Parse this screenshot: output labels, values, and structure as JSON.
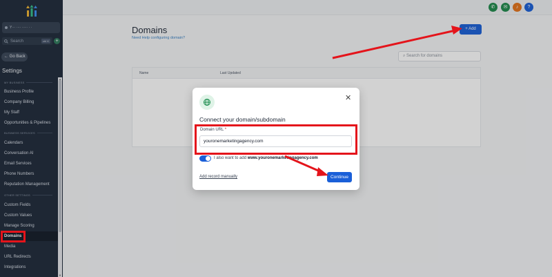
{
  "sidebar": {
    "location_name": "Y··· ···· ····· · ·",
    "search_placeholder": "Search",
    "search_shortcut": "ctrl K",
    "search_add": "+",
    "go_back": "Go Back",
    "settings_title": "Settings",
    "sections": {
      "my_business": "MY BUSINESS",
      "business_services": "BUSINESS SERVICES",
      "other_settings": "OTHER SETTINGS"
    },
    "items": [
      {
        "label": "Business Profile"
      },
      {
        "label": "Company Billing"
      },
      {
        "label": "My Staff"
      },
      {
        "label": "Opportunities & Pipelines"
      },
      {
        "label": "Calendars"
      },
      {
        "label": "Conversation AI"
      },
      {
        "label": "Email Services"
      },
      {
        "label": "Phone Numbers"
      },
      {
        "label": "Reputation Management"
      },
      {
        "label": "Custom Fields"
      },
      {
        "label": "Custom Values"
      },
      {
        "label": "Manage Scoring"
      },
      {
        "label": "Domains"
      },
      {
        "label": "Media"
      },
      {
        "label": "URL Redirects"
      },
      {
        "label": "Integrations"
      }
    ]
  },
  "topbar": {
    "icons": [
      "phone-icon",
      "megaphone-icon",
      "bell-icon",
      "help-icon"
    ],
    "colors": {
      "phone": "#1f8a4c",
      "megaphone": "#1f8a4c",
      "bell": "#e4731c",
      "help": "#1a5fd8"
    },
    "help_label": "?",
    "badge_count": "1"
  },
  "page": {
    "title": "Domains",
    "help_link": "Need Help configuring domain?",
    "add_button": "Add",
    "search_placeholder": "Search for domains",
    "table_headers": {
      "name": "Name",
      "last_updated": "Last Updated"
    }
  },
  "modal": {
    "title": "Connect your domain/subdomain",
    "field_label": "Domain URL",
    "required_mark": "*",
    "field_value": "youronemarketingagency.com",
    "toggle_text_prefix": "I also want to add",
    "toggle_text_domain": "www.youronemarketingagency.com",
    "add_record_link": "Add record manually",
    "continue_button": "Continue",
    "accent_color": "#1a5fd8"
  },
  "annotations": {
    "color": "#e4141b"
  }
}
